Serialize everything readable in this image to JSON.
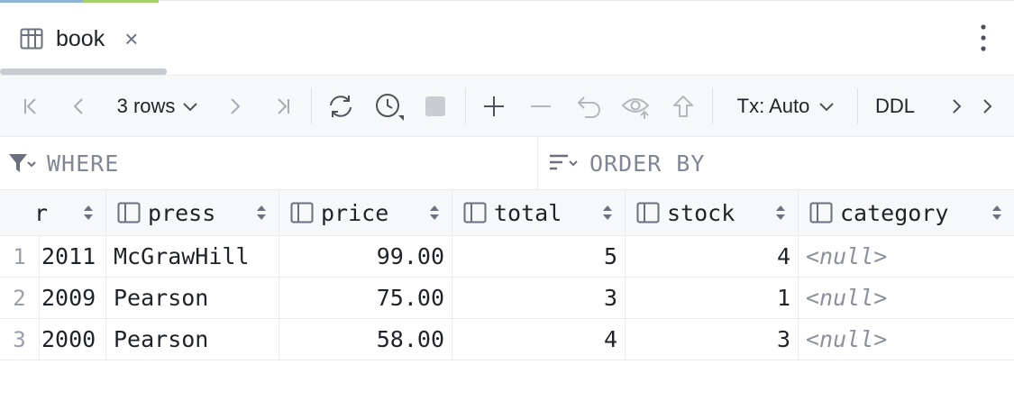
{
  "tab": {
    "title": "book",
    "close": "×",
    "icon": "table-icon"
  },
  "toolbar": {
    "rows_label": "3 rows",
    "tx_label": "Tx: Auto",
    "ddl_label": "DDL"
  },
  "filter": {
    "where_label": "WHERE",
    "order_label": "ORDER BY"
  },
  "grid": {
    "columns": [
      {
        "name": "",
        "truncated_header": "r"
      },
      {
        "name": "press"
      },
      {
        "name": "price"
      },
      {
        "name": "total"
      },
      {
        "name": "stock"
      },
      {
        "name": "category"
      }
    ],
    "rows": [
      {
        "num": "1",
        "year": "2011",
        "press": "McGrawHill",
        "price": "99.00",
        "total": "5",
        "stock": "4",
        "category": "<null>"
      },
      {
        "num": "2",
        "year": "2009",
        "press": "Pearson",
        "price": "75.00",
        "total": "3",
        "stock": "1",
        "category": "<null>"
      },
      {
        "num": "3",
        "year": "2000",
        "press": "Pearson",
        "price": "58.00",
        "total": "4",
        "stock": "3",
        "category": "<null>"
      }
    ]
  },
  "colors": {
    "accent_blue": "#8fb5d6",
    "accent_green": "#a6cf6a",
    "null_text": "#8c909b",
    "row_number": "#9a9ea8"
  }
}
